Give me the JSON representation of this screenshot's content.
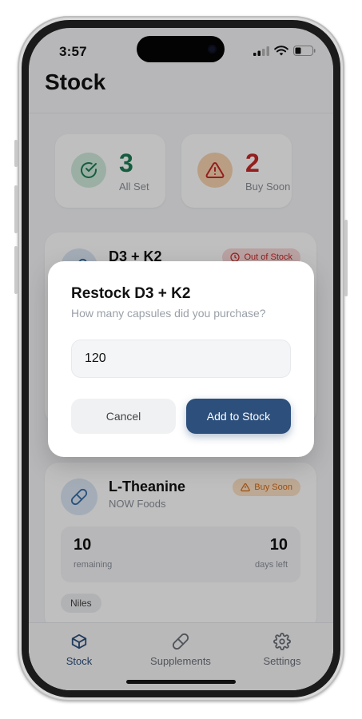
{
  "status_bar": {
    "time": "3:57"
  },
  "header": {
    "title": "Stock"
  },
  "summary": {
    "all_set": {
      "count": "3",
      "label": "All Set",
      "color": "#1e7d55"
    },
    "buy_soon": {
      "count": "2",
      "label": "Buy Soon",
      "color": "#c62828"
    }
  },
  "items": [
    {
      "name": "D3 + K2",
      "badge": "Out of Stock"
    },
    {
      "name": "L-Theanine",
      "brand": "NOW Foods",
      "badge": "Buy Soon",
      "remaining": "10",
      "remaining_label": "remaining",
      "days": "10",
      "days_label": "days left",
      "tag": "Niles"
    }
  ],
  "modal": {
    "title": "Restock D3 + K2",
    "subtitle": "How many capsules did you purchase?",
    "input_value": "120",
    "cancel_label": "Cancel",
    "confirm_label": "Add to Stock"
  },
  "tabs": [
    {
      "label": "Stock",
      "icon": "box-icon",
      "active": true
    },
    {
      "label": "Supplements",
      "icon": "pill-icon",
      "active": false
    },
    {
      "label": "Settings",
      "icon": "gear-icon",
      "active": false
    }
  ],
  "colors": {
    "accent": "#2c4f7c",
    "ok_green": "#1e7d55",
    "danger_red": "#c62828",
    "warn_orange": "#e07a1f"
  }
}
